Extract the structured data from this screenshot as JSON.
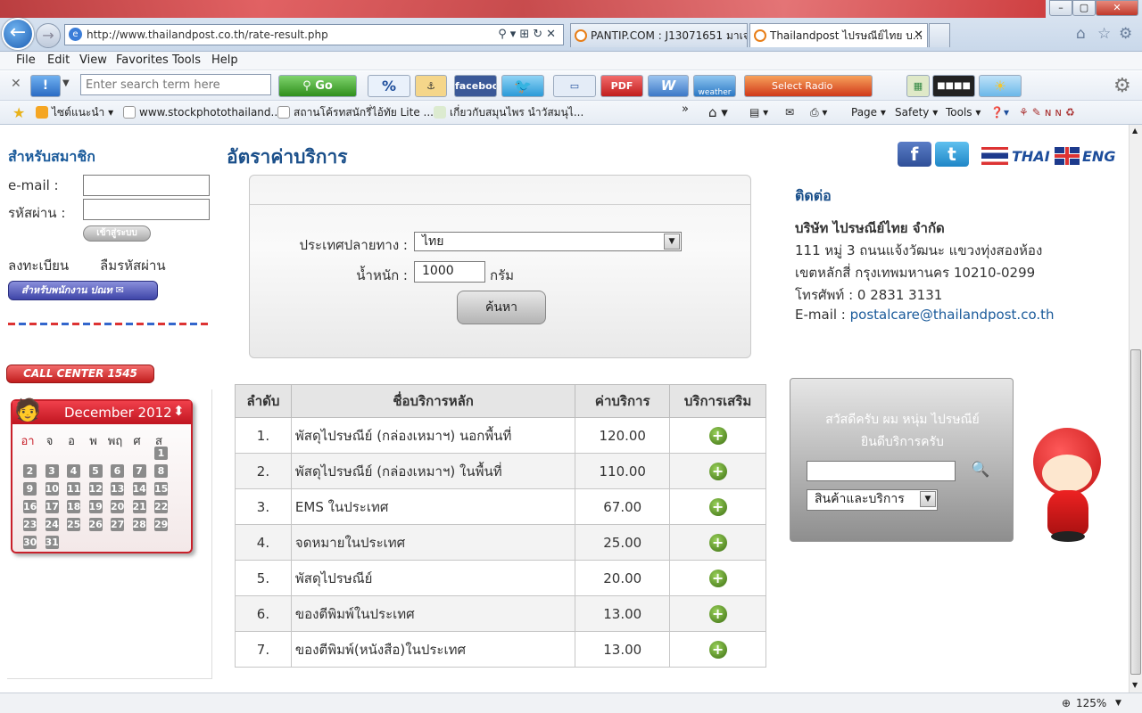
{
  "browser": {
    "address": "http://www.thailandpost.co.th/rate-result.php",
    "tabs": [
      {
        "label": "PANTIP.COM : J13071651 มาเจ..."
      },
      {
        "label": "Thailandpost ไปรษณีย์ไทย บ..."
      }
    ],
    "menu": [
      "File",
      "Edit",
      "View",
      "Favorites",
      "Tools",
      "Help"
    ],
    "search_placeholder": "Enter search term here",
    "go_label": "Go",
    "toolbar_buttons": {
      "facebook": "facebook",
      "pdf": "PDF",
      "weather": "weather",
      "radio": "Select Radio"
    },
    "favorites": [
      {
        "label": "ไซต์แนะนำ"
      },
      {
        "label": "www.stockphotothailand...."
      },
      {
        "label": "สถานโค้รทสนักรี่ไอ้ทัย  Lite ..."
      },
      {
        "label": "เกี่ยวกับสมุนไพร นำวัสมนุไ..."
      }
    ],
    "commands": [
      "Page",
      "Safety",
      "Tools"
    ],
    "zoom": "125%"
  },
  "left": {
    "member_title": "สำหรับสมาชิก",
    "email_label": "e-mail :",
    "password_label": "รหัสผ่าน :",
    "login_button": "เข้าสู่ระบบ",
    "register_link": "ลงทะเบียน",
    "forgot_link": "ลืมรหัสผ่าน",
    "staff_button": "สำหรับพนักงาน ปณท",
    "call_center": "CALL CENTER 1545",
    "calendar": {
      "month": "December 2012",
      "day_names": [
        "อา",
        "จ",
        "อ",
        "พ",
        "พฤ",
        "ศ",
        "ส"
      ],
      "days": [
        "1",
        "2",
        "3",
        "4",
        "5",
        "6",
        "7",
        "8",
        "9",
        "10",
        "11",
        "12",
        "13",
        "14",
        "15",
        "16",
        "17",
        "18",
        "19",
        "20",
        "21",
        "22",
        "23",
        "24",
        "25",
        "26",
        "27",
        "28",
        "29",
        "30",
        "31"
      ]
    }
  },
  "main": {
    "title": "อัตราค่าบริการ",
    "destination_label": "ประเทศปลายทาง :",
    "destination_value": "ไทย",
    "weight_label": "น้ำหนัก :",
    "weight_value": "1000",
    "weight_unit": "กรัม",
    "search_button": "ค้นหา",
    "table": {
      "headers": [
        "ลำดับ",
        "ชื่อบริการหลัก",
        "ค่าบริการ",
        "บริการเสริม"
      ],
      "rows": [
        {
          "no": "1.",
          "name": "พัสดุไปรษณีย์ (กล่องเหมาฯ) นอกพื้นที่",
          "price": "120.00"
        },
        {
          "no": "2.",
          "name": "พัสดุไปรษณีย์ (กล่องเหมาฯ) ในพื้นที่",
          "price": "110.00"
        },
        {
          "no": "3.",
          "name": "EMS ในประเทศ",
          "price": "67.00"
        },
        {
          "no": "4.",
          "name": "จดหมายในประเทศ",
          "price": "25.00"
        },
        {
          "no": "5.",
          "name": "พัสดุไปรษณีย์",
          "price": "20.00"
        },
        {
          "no": "6.",
          "name": "ของตีพิมพ์ในประเทศ",
          "price": "13.00"
        },
        {
          "no": "7.",
          "name": "ของตีพิมพ์(หนังสือ)ในประเทศ",
          "price": "13.00"
        }
      ]
    }
  },
  "right": {
    "lang_thai": "THAI",
    "lang_eng": "ENG",
    "contact_title": "ติดต่อ",
    "company": "บริษัท ไปรษณีย์ไทย จำกัด",
    "address1": "111 หมู่ 3 ถนนแจ้งวัฒนะ แขวงทุ่งสองห้อง",
    "address2": "เขตหลักสี่ กรุงเทพมหานคร 10210-0299",
    "phone": "โทรศัพท์ : 0 2831 3131",
    "email_label": "E-mail :",
    "email": "postalcare@thailandpost.co.th",
    "greeting1": "สวัสดีครับ ผม หนุ่ม ไปรษณีย์",
    "greeting2": "ยินดีบริการครับ",
    "category_select": "สินค้าและบริการ"
  },
  "colors": {
    "accent": "#1a4f8a",
    "red": "#c8202a"
  }
}
